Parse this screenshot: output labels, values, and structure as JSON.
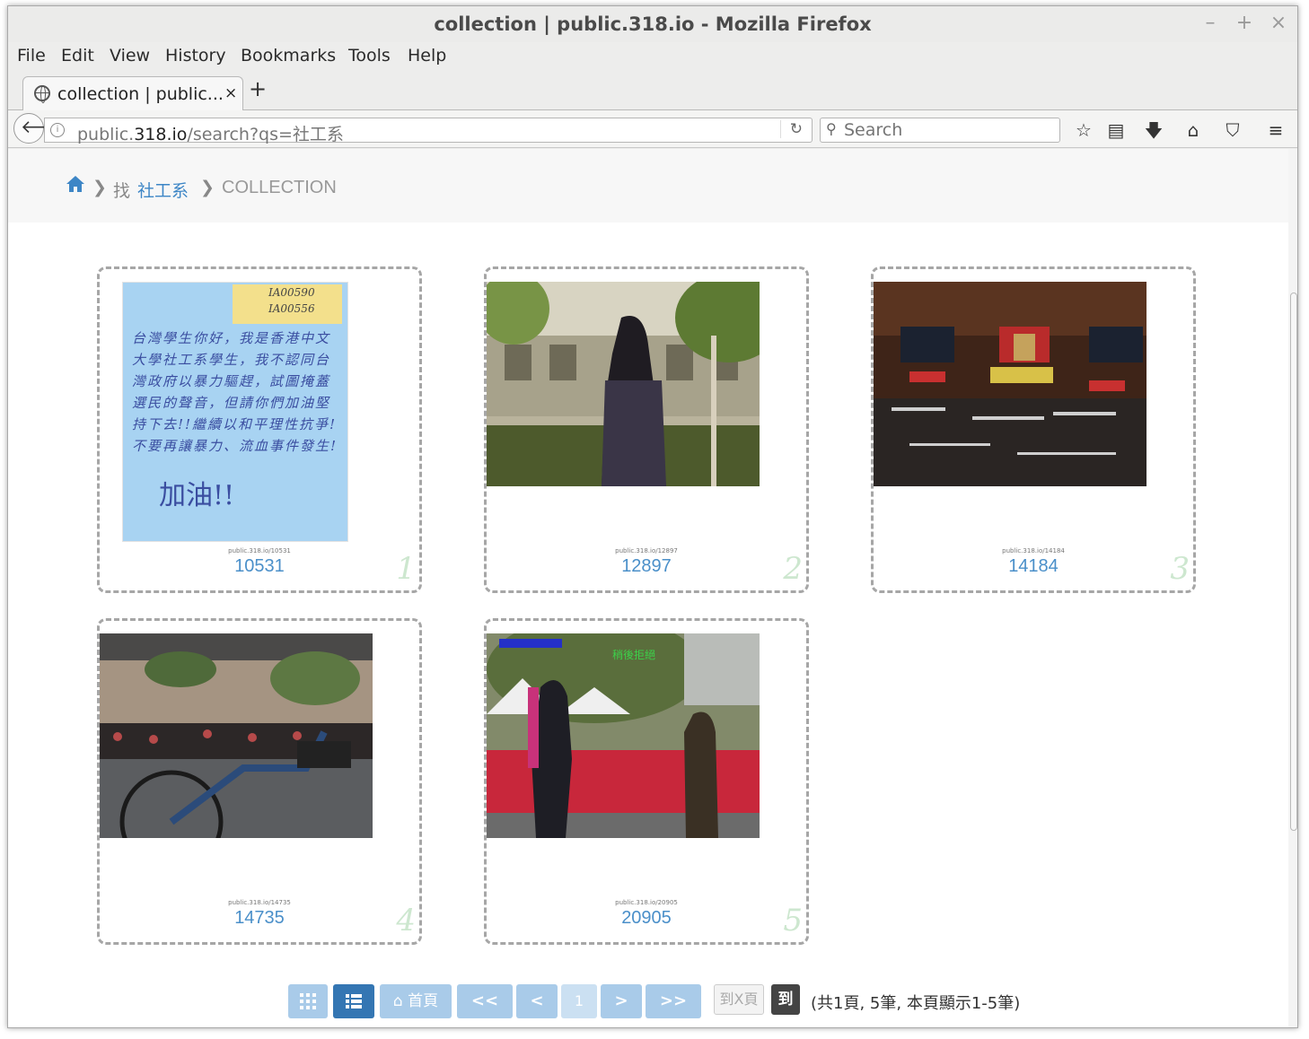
{
  "window": {
    "title": "collection | public.318.io - Mozilla Firefox",
    "minimize": "–",
    "maximize": "+",
    "close": "×"
  },
  "menu": [
    "File",
    "Edit",
    "View",
    "History",
    "Bookmarks",
    "Tools",
    "Help"
  ],
  "tab": {
    "label": "collection | public...",
    "close": "×",
    "new_tab": "+"
  },
  "nav": {
    "url_domain_prefix": "public.",
    "url_domain": "318.io",
    "url_path": "/search?qs=社工系",
    "reload": "↻",
    "search_placeholder": "Search"
  },
  "toolbar_icons": [
    "star-icon",
    "reading-list-icon",
    "download-icon",
    "home-icon",
    "pocket-icon",
    "menu-icon"
  ],
  "breadcrumb": {
    "sep": "❯",
    "find": "找",
    "query": "社工系",
    "section": "COLLECTION"
  },
  "cards": [
    {
      "id": "10531",
      "index": "1",
      "caption": "public.318.io/10531"
    },
    {
      "id": "12897",
      "index": "2",
      "caption": "public.318.io/12897"
    },
    {
      "id": "14184",
      "index": "3",
      "caption": "public.318.io/14184"
    },
    {
      "id": "14735",
      "index": "4",
      "caption": "public.318.io/14735"
    },
    {
      "id": "20905",
      "index": "5",
      "caption": "public.318.io/20905"
    }
  ],
  "note": {
    "sticky_1": "IA00590",
    "sticky_2": "IA00556",
    "text": "台灣學生你好，我是香港中文大學社工系學生，我不認同台灣政府以暴力驅趕，試圖掩蓋選民的聲音，但請你們加油堅持下去!!繼續以和平理性抗爭!不要再讓暴力、流血事件發生!",
    "jia": "加油!!"
  },
  "video5_overlay": "稍後拒絕",
  "pager": {
    "home": "首頁",
    "first": "<<",
    "prev": "<",
    "page": "1",
    "next": ">",
    "last": ">>",
    "goto_placeholder": "到X頁",
    "goto": "到",
    "info": "(共1頁, 5筆, 本頁顯示1-5筆)"
  }
}
